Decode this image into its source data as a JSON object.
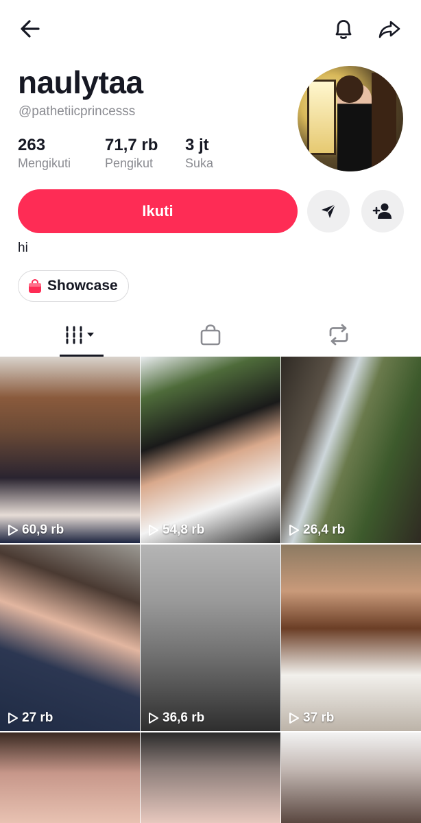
{
  "profile": {
    "username": "naulytaa",
    "handle": "@pathetiicprincesss",
    "bio": "hi",
    "stats": [
      {
        "value": "263",
        "label": "Mengikuti"
      },
      {
        "value": "71,7 rb",
        "label": "Pengikut"
      },
      {
        "value": "3 jt",
        "label": "Suka"
      }
    ]
  },
  "actions": {
    "follow_label": "Ikuti",
    "showcase_label": "Showcase"
  },
  "tabs": [
    {
      "icon": "videos-grid-icon",
      "active": true
    },
    {
      "icon": "shopping-bag-icon",
      "active": false
    },
    {
      "icon": "repost-icon",
      "active": false
    }
  ],
  "videos": [
    {
      "views": "60,9 rb"
    },
    {
      "views": "54,8 rb"
    },
    {
      "views": "26,4 rb"
    },
    {
      "views": "27 rb"
    },
    {
      "views": "36,6 rb"
    },
    {
      "views": "37 rb"
    },
    {
      "views": ""
    },
    {
      "views": ""
    },
    {
      "views": ""
    }
  ],
  "colors": {
    "accent": "#fe2c55",
    "text": "#161823",
    "muted": "#8a8b91",
    "button_gray": "#efeff0"
  }
}
